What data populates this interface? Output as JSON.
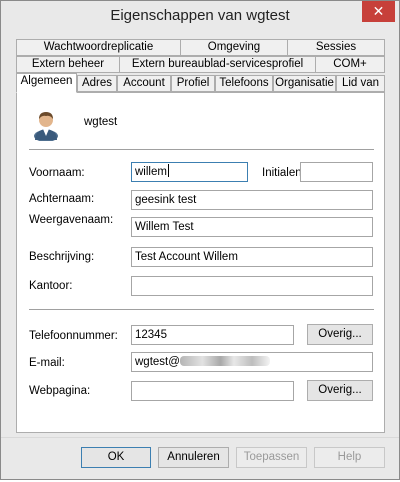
{
  "window": {
    "title": "Eigenschappen van wgtest",
    "close_glyph": "✕"
  },
  "tabs": {
    "row1": [
      "Wachtwoordreplicatie",
      "Omgeving",
      "Sessies"
    ],
    "row2": [
      "Extern beheer",
      "Extern bureaublad-servicesprofiel",
      "COM+"
    ],
    "row3": [
      "Algemeen",
      "Adres",
      "Account",
      "Profiel",
      "Telefoons",
      "Organisatie",
      "Lid van"
    ],
    "active": "Algemeen"
  },
  "general": {
    "avatar_icon": "user-icon",
    "display_user": "wgtest",
    "fields": {
      "first_name": {
        "label": "Voornaam:",
        "value": "willem"
      },
      "initials": {
        "label": "Initialen:",
        "value": ""
      },
      "last_name": {
        "label": "Achternaam:",
        "value": "geesink test"
      },
      "display_name": {
        "label": "Weergavenaam:",
        "value": "Willem Test"
      },
      "description": {
        "label": "Beschrijving:",
        "value": "Test Account Willem"
      },
      "office": {
        "label": "Kantoor:",
        "value": ""
      },
      "phone": {
        "label": "Telefoonnummer:",
        "value": "12345"
      },
      "email": {
        "label": "E-mail:",
        "value": "wgtest@"
      },
      "web_page": {
        "label": "Webpagina:",
        "value": ""
      }
    },
    "other_phone_button": "Overig...",
    "other_web_button": "Overig..."
  },
  "footer": {
    "ok": "OK",
    "cancel": "Annuleren",
    "apply": "Toepassen",
    "help": "Help"
  }
}
